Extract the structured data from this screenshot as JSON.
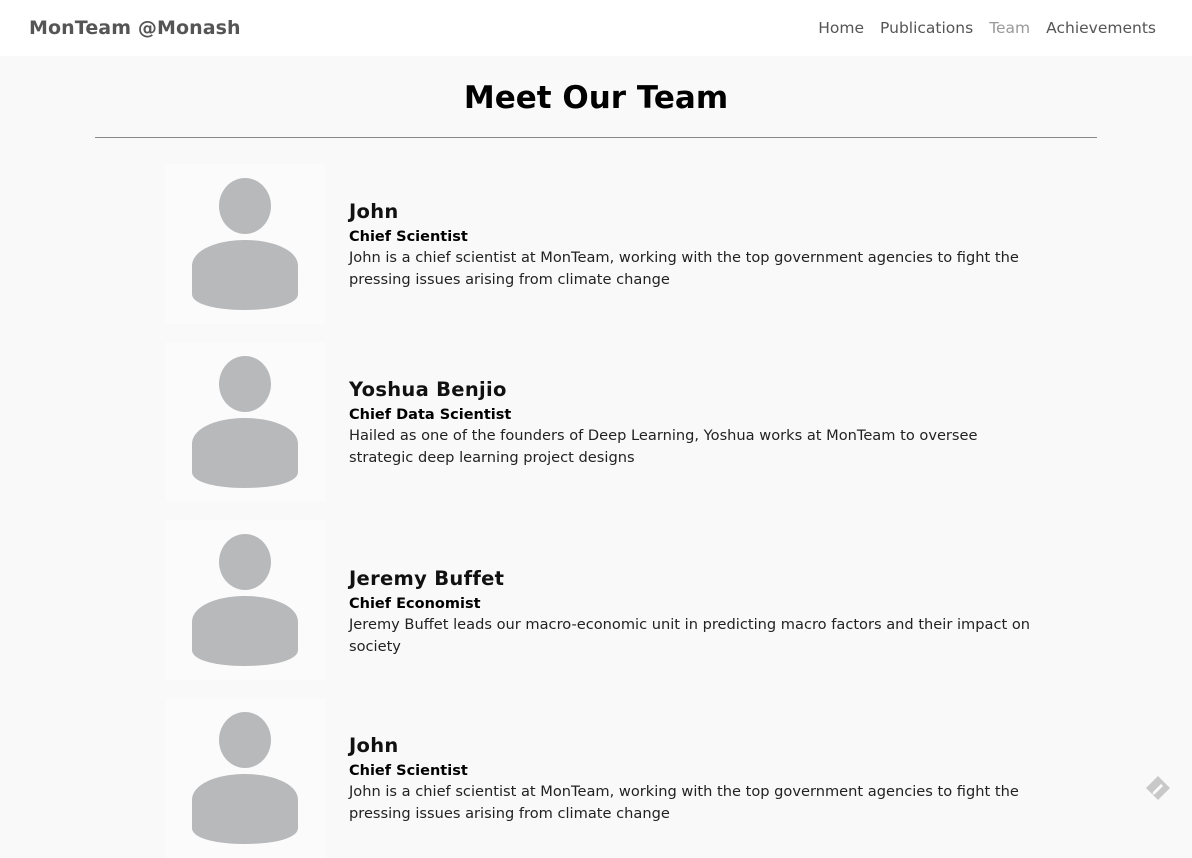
{
  "navbar": {
    "brand": "MonTeam @Monash",
    "links": [
      {
        "label": "Home",
        "active": false
      },
      {
        "label": "Publications",
        "active": false
      },
      {
        "label": "Team",
        "active": true
      },
      {
        "label": "Achievements",
        "active": false
      }
    ]
  },
  "page": {
    "title": "Meet Our Team"
  },
  "members": [
    {
      "name": "John",
      "role": "Chief Scientist",
      "description": "John is a chief scientist at MonTeam, working with the top government agencies to fight the pressing issues arising from climate change",
      "avatar_icon": "person-placeholder-icon"
    },
    {
      "name": "Yoshua Benjio",
      "role": "Chief Data Scientist",
      "description": "Hailed as one of the founders of Deep Learning, Yoshua works at MonTeam to oversee strategic deep learning project designs",
      "avatar_icon": "person-placeholder-icon"
    },
    {
      "name": "Jeremy Buffet",
      "role": "Chief Economist",
      "description": "Jeremy Buffet leads our macro-economic unit in predicting macro factors and their impact on society",
      "avatar_icon": "person-placeholder-icon"
    },
    {
      "name": "John",
      "role": "Chief Scientist",
      "description": "John is a chief scientist at MonTeam, working with the top government agencies to fight the pressing issues arising from climate change",
      "avatar_icon": "person-placeholder-icon"
    }
  ],
  "colors": {
    "background": "#f9f9f9",
    "navbar": "#ffffff",
    "avatar_silhouette": "#b8b9bb",
    "active_link": "#999999"
  }
}
